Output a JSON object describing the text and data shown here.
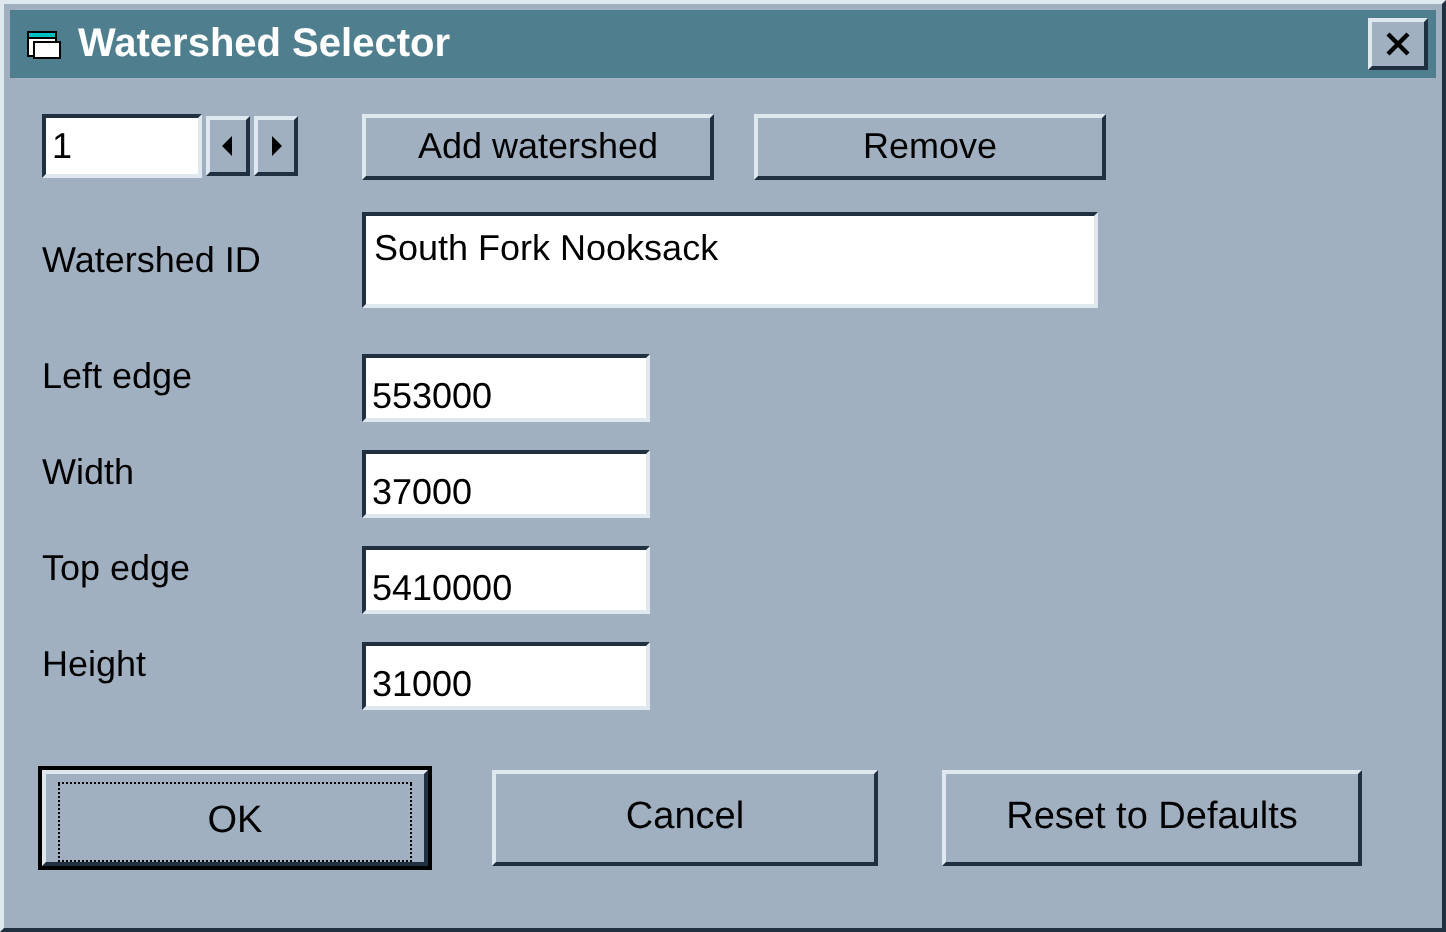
{
  "window": {
    "title": "Watershed Selector"
  },
  "spinner": {
    "value": "1"
  },
  "top_buttons": [
    "Add watershed",
    "Remove"
  ],
  "watershed_id": {
    "label": "Watershed ID",
    "value": "South Fork Nooksack"
  },
  "fields": [
    {
      "label": "Left edge",
      "value": "553000"
    },
    {
      "label": "Width",
      "value": "37000"
    },
    {
      "label": "Top edge",
      "value": "5410000"
    },
    {
      "label": "Height",
      "value": "31000"
    }
  ],
  "buttons": [
    {
      "label": "OK",
      "default": true
    },
    {
      "label": "Cancel",
      "default": false
    },
    {
      "label": "Reset to Defaults",
      "default": false
    }
  ]
}
